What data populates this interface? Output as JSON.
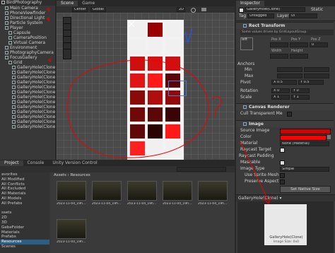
{
  "hierarchy": {
    "root": "BirdPhotography",
    "items": [
      {
        "label": "Main Camera",
        "indent": 1
      },
      {
        "label": "PhoneViewfinder",
        "indent": 1
      },
      {
        "label": "Directional Light",
        "indent": 1
      },
      {
        "label": "Particle System",
        "indent": 1
      },
      {
        "label": "Player",
        "indent": 1
      },
      {
        "label": "Capsule",
        "indent": 2
      },
      {
        "label": "CameraPosition",
        "indent": 2
      },
      {
        "label": "Virtual Camera",
        "indent": 2
      },
      {
        "label": "Environment",
        "indent": 1
      },
      {
        "label": "PhotographyCamera",
        "indent": 1
      },
      {
        "label": "FocusGallery",
        "indent": 1
      },
      {
        "label": "Grid",
        "indent": 2
      },
      {
        "label": "GalleryHole(Clone)",
        "indent": 3
      },
      {
        "label": "GalleryHole(Clone)",
        "indent": 3
      },
      {
        "label": "GalleryHole(Clone)",
        "indent": 3
      },
      {
        "label": "GalleryHole(Clone)",
        "indent": 3
      },
      {
        "label": "GalleryHole(Clone)",
        "indent": 3
      },
      {
        "label": "GalleryHole(Clone)",
        "indent": 3
      },
      {
        "label": "GalleryHole(Clone)",
        "indent": 3
      },
      {
        "label": "GalleryHole(Clone)",
        "indent": 3
      },
      {
        "label": "GalleryHole(Clone)",
        "indent": 3
      },
      {
        "label": "GalleryHole(Clone)",
        "indent": 3
      },
      {
        "label": "GalleryHole(Clone)",
        "indent": 3
      },
      {
        "label": "GalleryHole(Clone)",
        "indent": 3
      },
      {
        "label": "GalleryHole(Clone)",
        "indent": 3
      }
    ]
  },
  "scene": {
    "tabs": [
      "Scene",
      "Game"
    ],
    "toolbar": {
      "pivot": "Center",
      "space": "Global",
      "mode": "2D"
    }
  },
  "inspector": {
    "tab": "Inspector",
    "object_name": "GalleryHole(Clone)",
    "static_label": "Static",
    "tag_label": "Tag",
    "tag_value": "Untagged",
    "layer_label": "Layer",
    "layer_value": "UI",
    "rect_transform": "Rect Transform",
    "rect_note": "Some values driven by GridLayoutGroup.",
    "anchor_label": "left",
    "pos_x_label": "Pos X",
    "pos_y_label": "Pos Y",
    "pos_z_label": "Pos Z",
    "pos_z_value": "0",
    "width_label": "Width",
    "height_label": "Height",
    "anchors_label": "Anchors",
    "min_label": "Min",
    "max_label": "Max",
    "pivot_label": "Pivot",
    "pivot_x": "X 0.5",
    "pivot_y": "Y 0.5",
    "rotation_label": "Rotation",
    "rotation_x": "X 0",
    "rotation_y": "Y 0",
    "scale_label": "Scale",
    "scale_x": "X 1",
    "scale_y": "Y 1",
    "canvas_renderer": "Canvas Renderer",
    "cull_label": "Cull Transparent Me",
    "image_label": "Image",
    "source_image_label": "Source Image",
    "color_label": "Color",
    "material_label": "Material",
    "material_value": "None (Material)",
    "raycast_target": "Raycast Target",
    "raycast_padding": "Raycast Padding",
    "maskable": "Maskable",
    "image_type_label": "Image Type",
    "image_type_value": "Simple",
    "use_sprite_mesh": "Use Sprite Mesh",
    "preserve_aspect": "Preserve Aspect",
    "set_native_size": "Set Native Size",
    "preview_title": "GalleryHole(Clone) ▾",
    "preview_caption": "GalleryHole(Clone)",
    "preview_sub": "Image Size: 0x0",
    "colors": {
      "color_swatch": "#ff0000",
      "source_swatch": "#d40000"
    }
  },
  "bottom": {
    "tabs": [
      "Project",
      "Console",
      "Unity Version Control"
    ],
    "breadcrumb_root": "Assets",
    "breadcrumb_sep": "›",
    "breadcrumb_leaf": "Resources",
    "project_items": [
      {
        "label": "avorites",
        "sel": false
      },
      {
        "label": "All Modified",
        "sel": false
      },
      {
        "label": "All Conflicts",
        "sel": false
      },
      {
        "label": "All Excluded",
        "sel": false
      },
      {
        "label": "All Materials",
        "sel": false
      },
      {
        "label": "All Models",
        "sel": false
      },
      {
        "label": "All Prefabs",
        "sel": false
      },
      {
        "label": "",
        "sel": false
      },
      {
        "label": "ssets",
        "sel": false
      },
      {
        "label": "2D",
        "sel": false
      },
      {
        "label": "3D",
        "sel": false
      },
      {
        "label": "GebeFolder",
        "sel": false
      },
      {
        "label": "Materials",
        "sel": false
      },
      {
        "label": "Prefabs",
        "sel": false
      },
      {
        "label": "Resources",
        "sel": true
      },
      {
        "label": "Scenes",
        "sel": false
      }
    ],
    "assets": [
      {
        "label": "2023-11-04_19h..."
      },
      {
        "label": "2023-11-04_19h..."
      },
      {
        "label": "2023-11-04_19h..."
      },
      {
        "label": "2023-11-04_19h..."
      },
      {
        "label": "2023-11-04_19h..."
      },
      {
        "label": "2023-11-04_19h..."
      }
    ]
  },
  "grid_cells": [
    {
      "color": "#f0f0f0"
    },
    {
      "color": "#9a0000"
    },
    {
      "color": "#f0f0f0"
    },
    {
      "color": "#f0f0f0"
    },
    {
      "color": "#f0f0f0"
    },
    {
      "color": "#f0f0f0"
    },
    {
      "color": "#cc1010"
    },
    {
      "color": "#d81010"
    },
    {
      "color": "#d01010"
    },
    {
      "color": "#e01515"
    },
    {
      "color": "#ff1a1a"
    },
    {
      "color": "#5a0606"
    },
    {
      "color": "#8a0a0a"
    },
    {
      "color": "#b00d0d"
    },
    {
      "color": "#900a0a"
    },
    {
      "color": "#700808"
    },
    {
      "color": "#5a0707"
    },
    {
      "color": "#3a0404"
    },
    {
      "color": "#600707"
    },
    {
      "color": "#2a0303"
    },
    {
      "color": "#ff1a1a"
    },
    {
      "color": "#ff2020"
    },
    {
      "color": "#f0f0f0"
    },
    {
      "color": "#f0f0f0"
    }
  ]
}
